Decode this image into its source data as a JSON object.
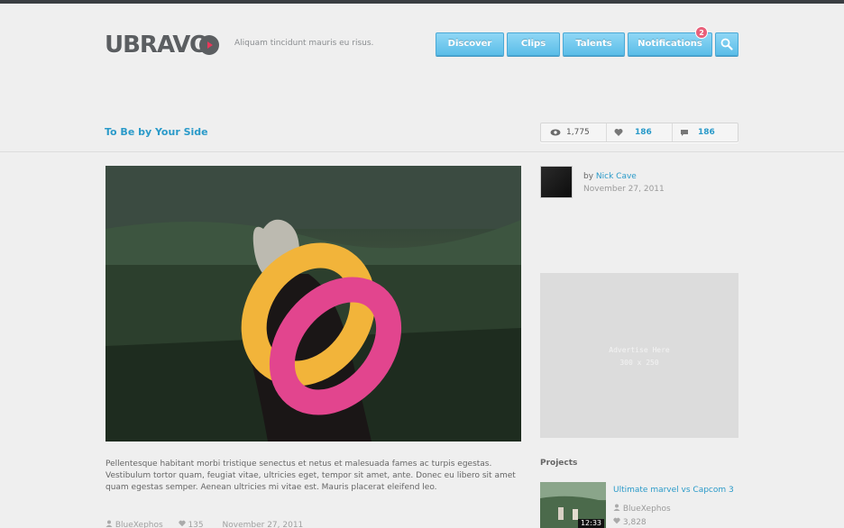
{
  "header": {
    "logo_text": "UBRAVO",
    "tagline": "Aliquam tincidunt mauris eu risus.",
    "nav": [
      {
        "label": "Discover"
      },
      {
        "label": "Clips"
      },
      {
        "label": "Talents"
      },
      {
        "label": "Notifications"
      }
    ],
    "notification_count": "2",
    "search_icon": "search-icon",
    "accent_color": "#5bbde8",
    "badge_color": "#e8607a"
  },
  "post": {
    "title": "To Be by Your Side",
    "views": "1,775",
    "likes": "186",
    "comments": "186",
    "author_prefix": "by",
    "author": "Nick Cave",
    "date": "November 27, 2011",
    "description": "Pellentesque habitant morbi tristique senectus et netus et malesuada fames ac turpis egestas. Vestibulum tortor quam, feugiat vitae, ultricies eget, tempor sit amet, ante. Donec eu libero sit amet quam egestas semper. Aenean ultricies mi vitae est. Mauris placerat eleifend leo.",
    "meta": {
      "user": "BlueXephos",
      "likes": "135",
      "date": "November 27, 2011"
    }
  },
  "ad": {
    "line1": "Advertise Here",
    "line2": "300 x 250"
  },
  "projects": {
    "title": "Projects",
    "items": [
      {
        "title": "Ultimate marvel vs Capcom 3",
        "author": "BlueXephos",
        "likes": "3,828",
        "duration": "12:33"
      }
    ]
  }
}
